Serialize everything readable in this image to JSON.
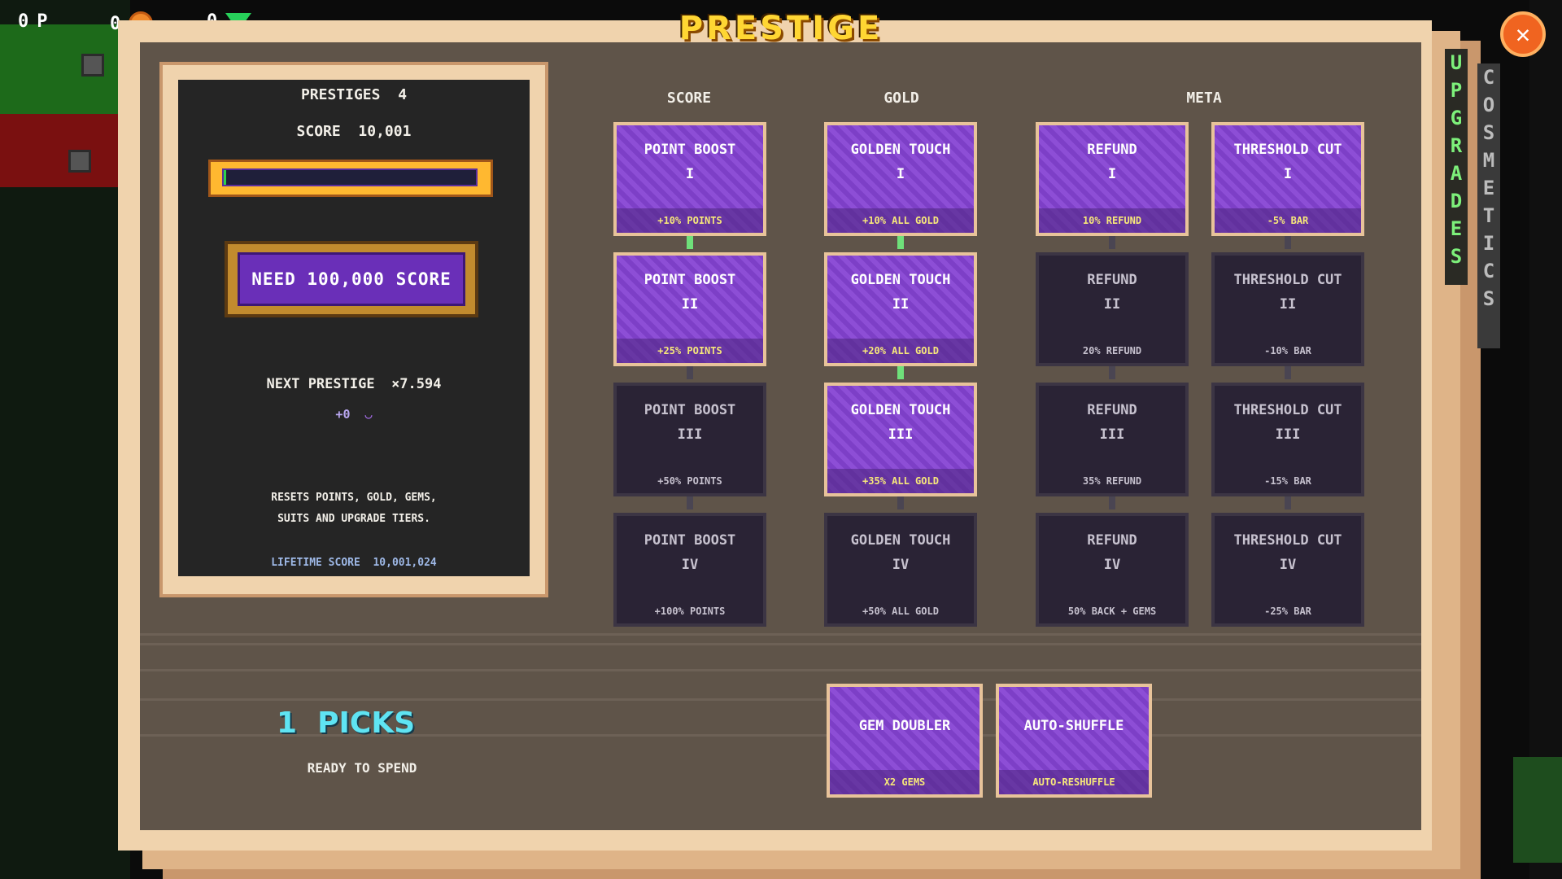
{
  "hud": {
    "points_value": "0",
    "points_label": "P",
    "coins_value": "0",
    "gems_value": "0"
  },
  "title": "PRESTIGE",
  "close_label": "✕",
  "tabs": {
    "upgrades": "UPGRADES",
    "cosmetics": "COSMETICS"
  },
  "left_panel": {
    "prestiges_label": "PRESTIGES",
    "prestiges_value": "4",
    "score_label": "SCORE",
    "score_value": "10,001",
    "progress_fraction": 0.01,
    "need_button": "NEED 100,000 SCORE",
    "next_prestige_label": "NEXT PRESTIGE",
    "next_prestige_value": "×7.594",
    "gain_value": "+0",
    "reset_line1": "RESETS POINTS, GOLD, GEMS,",
    "reset_line2": "SUITS AND UPGRADE TIERS.",
    "lifetime_label": "LIFETIME SCORE",
    "lifetime_value": "10,001,024"
  },
  "columns": {
    "score": "SCORE",
    "gold": "GOLD",
    "meta": "META"
  },
  "tree": {
    "score": [
      {
        "name": "POINT BOOST",
        "tier": "I",
        "bonus": "+10% POINTS",
        "state": "active"
      },
      {
        "name": "POINT BOOST",
        "tier": "II",
        "bonus": "+25% POINTS",
        "state": "active"
      },
      {
        "name": "POINT BOOST",
        "tier": "III",
        "bonus": "+50% POINTS",
        "state": "locked"
      },
      {
        "name": "POINT BOOST",
        "tier": "IV",
        "bonus": "+100% POINTS",
        "state": "locked"
      }
    ],
    "gold": [
      {
        "name": "GOLDEN TOUCH",
        "tier": "I",
        "bonus": "+10% ALL GOLD",
        "state": "active"
      },
      {
        "name": "GOLDEN TOUCH",
        "tier": "II",
        "bonus": "+20% ALL GOLD",
        "state": "active"
      },
      {
        "name": "GOLDEN TOUCH",
        "tier": "III",
        "bonus": "+35% ALL GOLD",
        "state": "active"
      },
      {
        "name": "GOLDEN TOUCH",
        "tier": "IV",
        "bonus": "+50% ALL GOLD",
        "state": "locked"
      }
    ],
    "refund": [
      {
        "name": "REFUND",
        "tier": "I",
        "bonus": "10% REFUND",
        "state": "active"
      },
      {
        "name": "REFUND",
        "tier": "II",
        "bonus": "20% REFUND",
        "state": "locked"
      },
      {
        "name": "REFUND",
        "tier": "III",
        "bonus": "35% REFUND",
        "state": "locked"
      },
      {
        "name": "REFUND",
        "tier": "IV",
        "bonus": "50% BACK + GEMS",
        "state": "locked"
      }
    ],
    "threshold": [
      {
        "name": "THRESHOLD CUT",
        "tier": "I",
        "bonus": "-5% BAR",
        "state": "active"
      },
      {
        "name": "THRESHOLD CUT",
        "tier": "II",
        "bonus": "-10% BAR",
        "state": "locked"
      },
      {
        "name": "THRESHOLD CUT",
        "tier": "III",
        "bonus": "-15% BAR",
        "state": "locked"
      },
      {
        "name": "THRESHOLD CUT",
        "tier": "IV",
        "bonus": "-25% BAR",
        "state": "locked"
      }
    ]
  },
  "extras": [
    {
      "name": "GEM DOUBLER",
      "bonus": "X2 GEMS"
    },
    {
      "name": "AUTO-SHUFFLE",
      "bonus": "AUTO-RESHUFFLE"
    }
  ],
  "picks": {
    "count": "1",
    "label": "PICKS",
    "sub": "READY TO SPEND"
  },
  "colors": {
    "accent_purple": "#7d3fc7",
    "title_gold": "#ffd633",
    "picks_cyan": "#5fe4f3",
    "link_green": "#6fe07a"
  }
}
